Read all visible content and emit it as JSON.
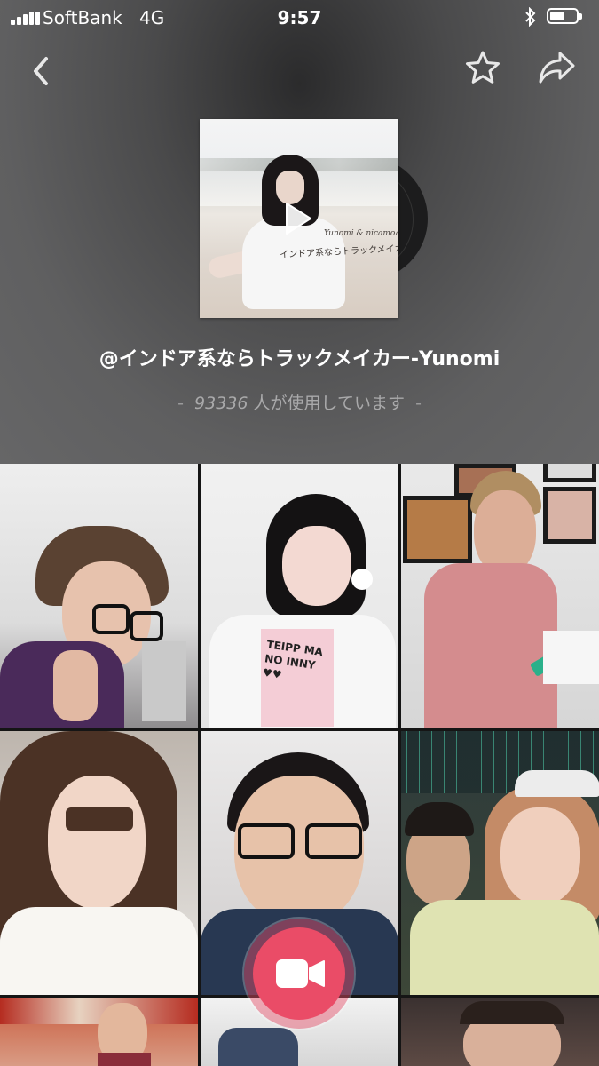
{
  "status_bar": {
    "carrier": "SoftBank",
    "network": "4G",
    "time": "9:57"
  },
  "nav": {
    "back_icon": "chevron-left-icon",
    "favorite_icon": "star-icon",
    "share_icon": "share-arrow-icon"
  },
  "album": {
    "caption_top": "Yunomi & nicamoq",
    "caption": "インドア系ならトラックメイカー"
  },
  "song": {
    "title": "@インドア系ならトラックメイカー-Yunomi",
    "usage_count": "93336",
    "usage_suffix": "人が使用しています",
    "dash": "-"
  },
  "badge": {
    "shirt_text": "TEIPP MANO INNY ♥♥"
  },
  "colors": {
    "accent": "#ea4c67",
    "header_bg": "#5f5f60",
    "grid_bg": "#151515"
  },
  "record": {
    "icon": "video-camera-icon"
  }
}
